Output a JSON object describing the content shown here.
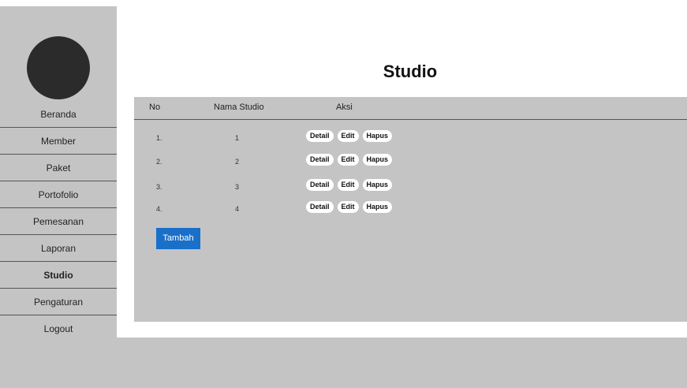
{
  "page": {
    "title": "Studio"
  },
  "sidebar": {
    "items": [
      {
        "label": "Beranda"
      },
      {
        "label": "Member"
      },
      {
        "label": "Paket"
      },
      {
        "label": "Portofolio"
      },
      {
        "label": "Pemesanan"
      },
      {
        "label": "Laporan"
      },
      {
        "label": "Studio"
      },
      {
        "label": "Pengaturan"
      },
      {
        "label": "Logout"
      }
    ],
    "active_item": "Studio"
  },
  "table": {
    "headers": [
      "No",
      "Nama Studio",
      "Aksi"
    ],
    "rows": [
      {
        "no": "1.",
        "name": "1"
      },
      {
        "no": "2.",
        "name": "2"
      },
      {
        "no": "3.",
        "name": "3"
      },
      {
        "no": "4.",
        "name": "4"
      }
    ],
    "actions": [
      "Detail",
      "Edit",
      "Hapus"
    ]
  },
  "add_button": {
    "label": "Tambah"
  },
  "colors": {
    "panel": "#c4c4c4",
    "avatar": "#2b2b2b",
    "primary_button": "#1a6fc9"
  }
}
